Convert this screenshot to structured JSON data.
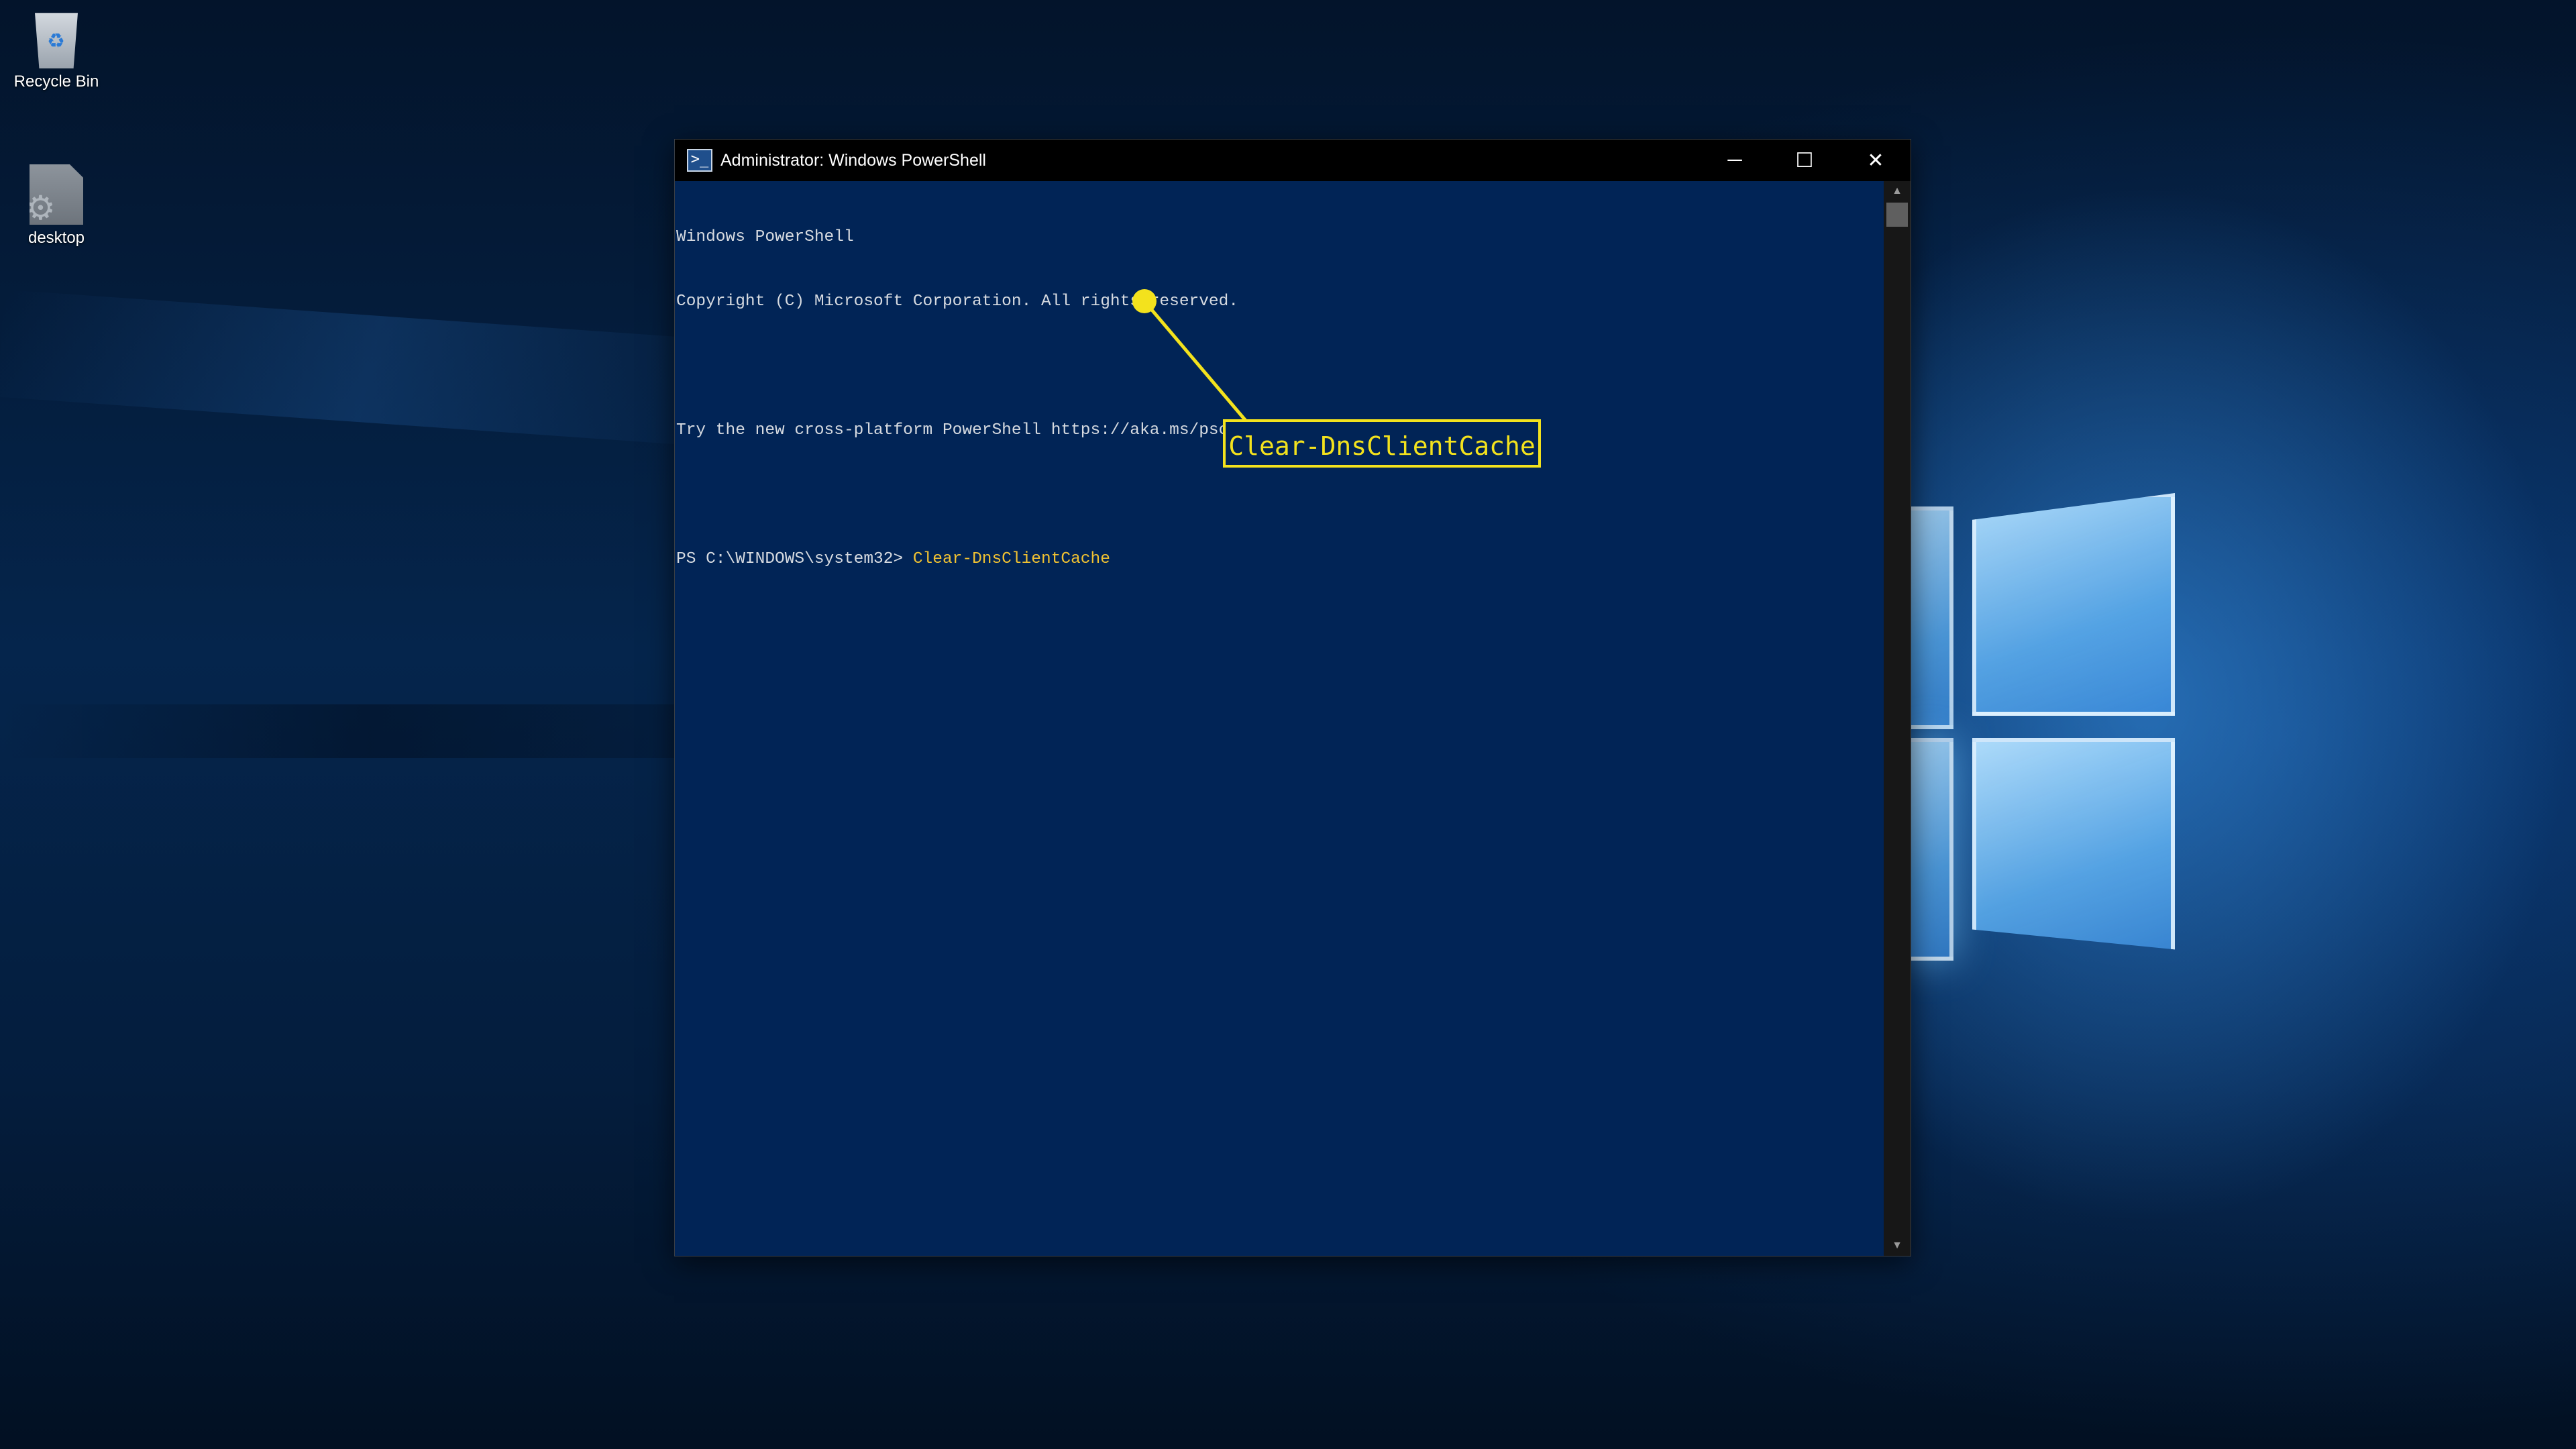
{
  "desktop": {
    "icons": [
      {
        "label": "Recycle Bin",
        "icon": "recycle-bin-icon"
      },
      {
        "label": "desktop",
        "icon": "settings-shortcut-icon"
      }
    ]
  },
  "window": {
    "title": "Administrator: Windows PowerShell",
    "controls": {
      "minimize": "─",
      "maximize": "☐",
      "close": "✕"
    }
  },
  "console": {
    "lines": [
      "Windows PowerShell",
      "Copyright (C) Microsoft Corporation. All rights reserved.",
      "",
      "Try the new cross-platform PowerShell https://aka.ms/pscore6",
      ""
    ],
    "prompt": "PS C:\\WINDOWS\\system32> ",
    "command": "Clear-DnsClientCache"
  },
  "annotation": {
    "label": "Clear-DnsClientCache",
    "color": "#f3e21d"
  },
  "colors": {
    "console_bg": "#012456",
    "command_text": "#f1c232"
  }
}
